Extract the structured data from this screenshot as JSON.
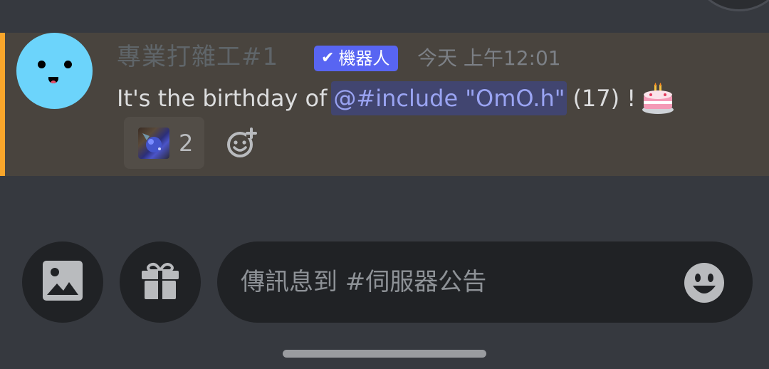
{
  "message": {
    "author": "專業打雜工#1",
    "bot_tag": "機器人",
    "timestamp": "今天 上午12:01",
    "text_before": "It's the birthday of",
    "mention": "@#include \"OmO.h\"",
    "text_after": "(17) !",
    "reactions": [
      {
        "emoji": "custom-emoji",
        "count": "2"
      }
    ]
  },
  "composer": {
    "placeholder": "傳訊息到 #伺服器公告"
  },
  "colors": {
    "background": "#36393f",
    "highlight_bg": "#49443e",
    "accent": "#f9a62b",
    "bot_tag": "#5865f2",
    "mention_text": "#9aa4f3",
    "avatar": "#6cd4fb"
  },
  "icons": {
    "image_button": "image-icon",
    "gift_button": "gift-icon",
    "emoji_button": "smiley-icon",
    "add_reaction": "add-reaction-icon",
    "cake": "birthday-cake-icon",
    "bot_check": "checkmark-icon"
  }
}
